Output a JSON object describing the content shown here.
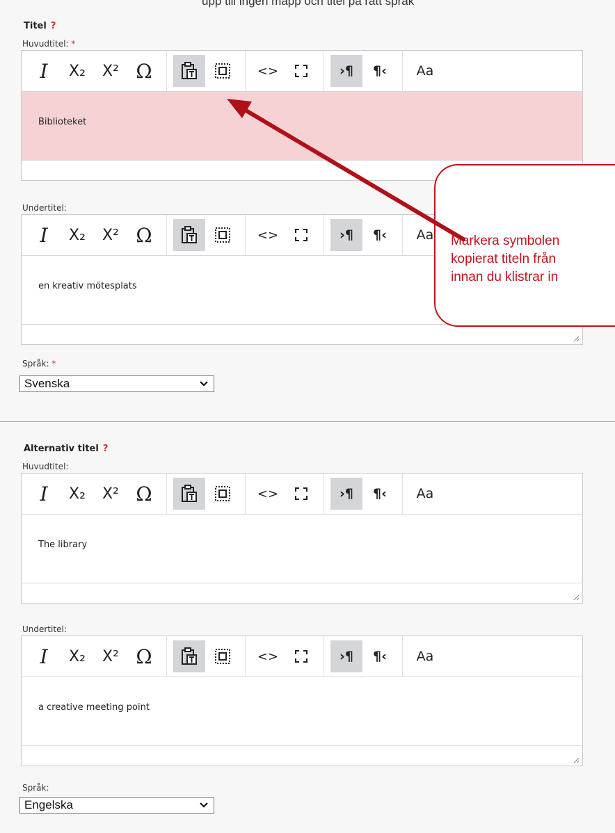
{
  "top_strip": "upp till ingen mapp och titel på rätt språk",
  "sections": [
    {
      "title": "Titel",
      "help": "?",
      "fields": [
        {
          "label": "Huvudtitel:",
          "required": "*",
          "value": "Biblioteket",
          "error": true,
          "resizable": false
        },
        {
          "label": "Undertitel:",
          "required": "",
          "value": "en kreativ mötesplats",
          "error": false,
          "resizable": true
        }
      ],
      "language": {
        "label": "Språk:",
        "required": "*",
        "value": "Svenska"
      }
    },
    {
      "title": "Alternativ titel",
      "help": "?",
      "fields": [
        {
          "label": "Huvudtitel:",
          "required": "",
          "value": "The library",
          "error": false,
          "resizable": true
        },
        {
          "label": "Undertitel:",
          "required": "",
          "value": "a creative meeting point",
          "error": false,
          "resizable": true
        }
      ],
      "language": {
        "label": "Språk:",
        "required": "",
        "value": "Engelska"
      }
    }
  ],
  "toolbar": {
    "italic": "I",
    "subscript": "X₂",
    "superscript": "X²",
    "omega": "Ω",
    "paste_icon": "paste-text-icon",
    "select_all_icon": "select-all-icon",
    "source": "<>",
    "maximize_icon": "maximize-icon",
    "ltr": "›¶",
    "rtl": "¶‹",
    "styles": "Aa"
  },
  "callout": {
    "lines": [
      "Markera symbolen",
      "kopierat titeln från",
      "innan du klistrar in"
    ]
  },
  "colors": {
    "accent_red": "#c0141c",
    "error_bg": "#f6d2d4",
    "active_button": "#d3d5d8",
    "divider": "#8aa2c4"
  }
}
